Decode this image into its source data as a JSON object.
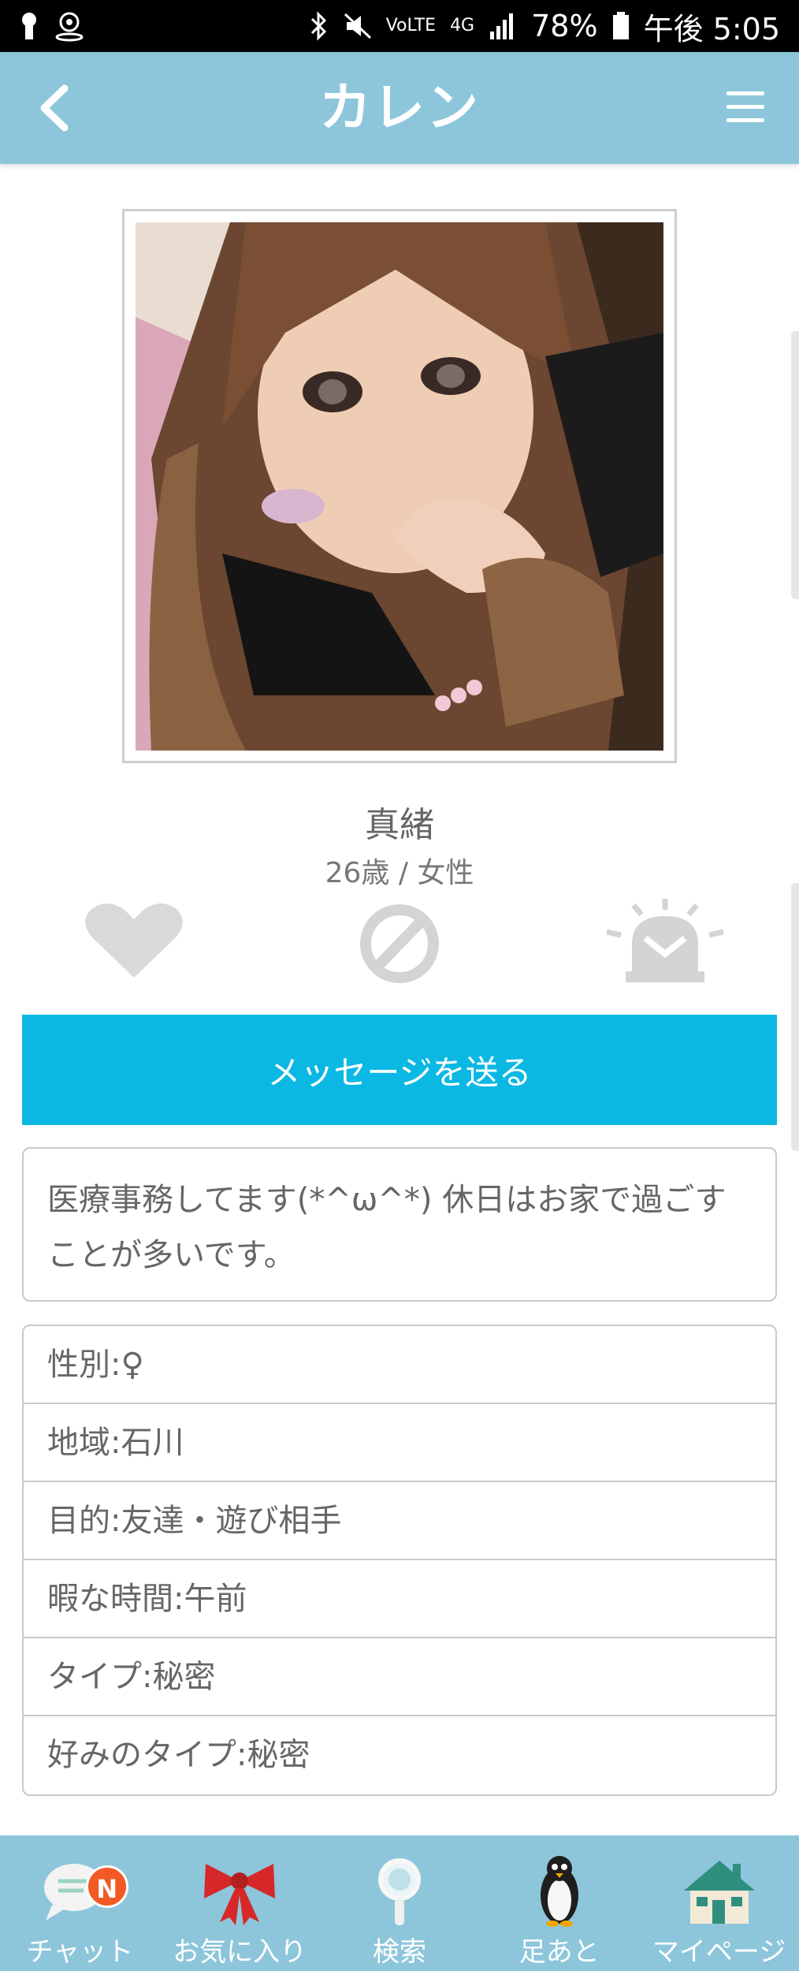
{
  "status_bar": {
    "battery": "78%",
    "time": "午後 5:05",
    "network": "4G",
    "volte": "VoLTE"
  },
  "header": {
    "title": "カレン"
  },
  "profile": {
    "name": "真緒",
    "age_gender": "26歳 / 女性"
  },
  "actions": {
    "message_button": "メッセージを送る"
  },
  "intro": "医療事務してます(*^ω^*) 休日はお家で過ごすことが多いです。",
  "details": [
    {
      "label": "性別:♀"
    },
    {
      "label": "地域:石川"
    },
    {
      "label": "目的:友達・遊び相手"
    },
    {
      "label": "暇な時間:午前"
    },
    {
      "label": "タイプ:秘密"
    },
    {
      "label": "好みのタイプ:秘密"
    }
  ],
  "tabbar": {
    "items": [
      {
        "label": "チャット",
        "icon": "chat-icon",
        "badge": "N"
      },
      {
        "label": "お気に入り",
        "icon": "ribbon-icon"
      },
      {
        "label": "検索",
        "icon": "magnifier-icon"
      },
      {
        "label": "足あと",
        "icon": "penguin-icon"
      },
      {
        "label": "マイページ",
        "icon": "house-icon"
      }
    ]
  },
  "colors": {
    "header": "#8dc6db",
    "message_button": "#0bb8e3",
    "badge": "#f15a24"
  }
}
